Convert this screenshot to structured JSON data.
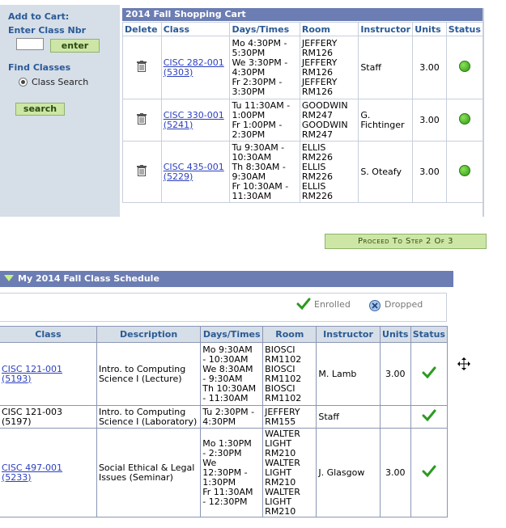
{
  "add_to_cart": {
    "title": "Add to Cart:",
    "enter_nbr_label": "Enter Class Nbr",
    "nbr_value": "",
    "enter_button": "enter",
    "find_classes_label": "Find Classes",
    "class_search_option": "Class Search",
    "search_button": "search"
  },
  "cart": {
    "title": "2014 Fall Shopping Cart",
    "headers": [
      "Delete",
      "Class",
      "Days/Times",
      "Room",
      "Instructor",
      "Units",
      "Status"
    ],
    "rows": [
      {
        "class_line1": "CISC 282-001",
        "class_line2": "(5303)",
        "days_times": [
          "Mo 4:30PM -",
          "5:30PM",
          "We 3:30PM -",
          "4:30PM",
          "Fr 2:30PM -",
          "3:30PM"
        ],
        "room": [
          "JEFFERY",
          "RM126",
          "JEFFERY",
          "RM126",
          "JEFFERY",
          "RM126"
        ],
        "instructor": [
          "Staff"
        ],
        "units": "3.00"
      },
      {
        "class_line1": "CISC 330-001",
        "class_line2": "(5241)",
        "days_times": [
          "Tu 11:30AM -",
          "1:00PM",
          "Fr 1:00PM -",
          "2:30PM"
        ],
        "room": [
          "GOODWIN",
          "RM247",
          "GOODWIN",
          "RM247"
        ],
        "instructor": [
          "G.",
          "Fichtinger"
        ],
        "units": "3.00"
      },
      {
        "class_line1": "CISC 435-001",
        "class_line2": "(5229)",
        "days_times": [
          "Tu 9:30AM -",
          "10:30AM",
          "Th 8:30AM -",
          "9:30AM",
          "Fr 10:30AM -",
          "11:30AM"
        ],
        "room": [
          "ELLIS",
          "RM226",
          "ELLIS",
          "RM226",
          "ELLIS",
          "RM226"
        ],
        "instructor": [
          "S. Oteafy"
        ],
        "units": "3.00"
      }
    ]
  },
  "proceed_button": "Proceed To Step 2 Of 3",
  "schedule": {
    "title": "My 2014 Fall Class Schedule",
    "legend_enrolled": "Enrolled",
    "legend_dropped": "Dropped",
    "headers": [
      "Class",
      "Description",
      "Days/Times",
      "Room",
      "Instructor",
      "Units",
      "Status"
    ],
    "rows": [
      {
        "class_line1": "CISC 121-001",
        "class_line2": "(5193)",
        "linked": true,
        "description": [
          "Intro. to Computing",
          "Science I (Lecture)"
        ],
        "days_times": [
          "Mo 9:30AM",
          "- 10:30AM",
          "We 8:30AM",
          "- 9:30AM",
          "Th 10:30AM",
          "- 11:30AM"
        ],
        "room": [
          "BIOSCI",
          "RM1102",
          "BIOSCI",
          "RM1102",
          "BIOSCI",
          "RM1102"
        ],
        "instructor": "M. Lamb",
        "units": "3.00"
      },
      {
        "class_line1": "CISC 121-003",
        "class_line2": "(5197)",
        "linked": false,
        "description": [
          "Intro. to Computing",
          "Science I (Laboratory)"
        ],
        "days_times": [
          "Tu 2:30PM -",
          "4:30PM"
        ],
        "room": [
          "JEFFERY",
          "RM155"
        ],
        "instructor": "Staff",
        "units": ""
      },
      {
        "class_line1": "CISC 497-001",
        "class_line2": "(5233)",
        "linked": true,
        "description": [
          "Social Ethical & Legal",
          "Issues (Seminar)"
        ],
        "days_times": [
          "Mo 1:30PM",
          "- 2:30PM",
          "We",
          "12:30PM -",
          "1:30PM",
          "Fr 11:30AM",
          "- 12:30PM"
        ],
        "room": [
          "WALTER",
          "LIGHT",
          "RM210",
          "WALTER",
          "LIGHT",
          "RM210",
          "WALTER",
          "LIGHT",
          "RM210"
        ],
        "instructor": "J. Glasgow",
        "units": "3.00"
      }
    ]
  },
  "colors": {
    "title_bar": "#6b7db3",
    "panel_bg": "#d6dee8",
    "button_bg": "#cde6a6",
    "link": "#2b3fbf",
    "status_green": "#2f9a12"
  }
}
